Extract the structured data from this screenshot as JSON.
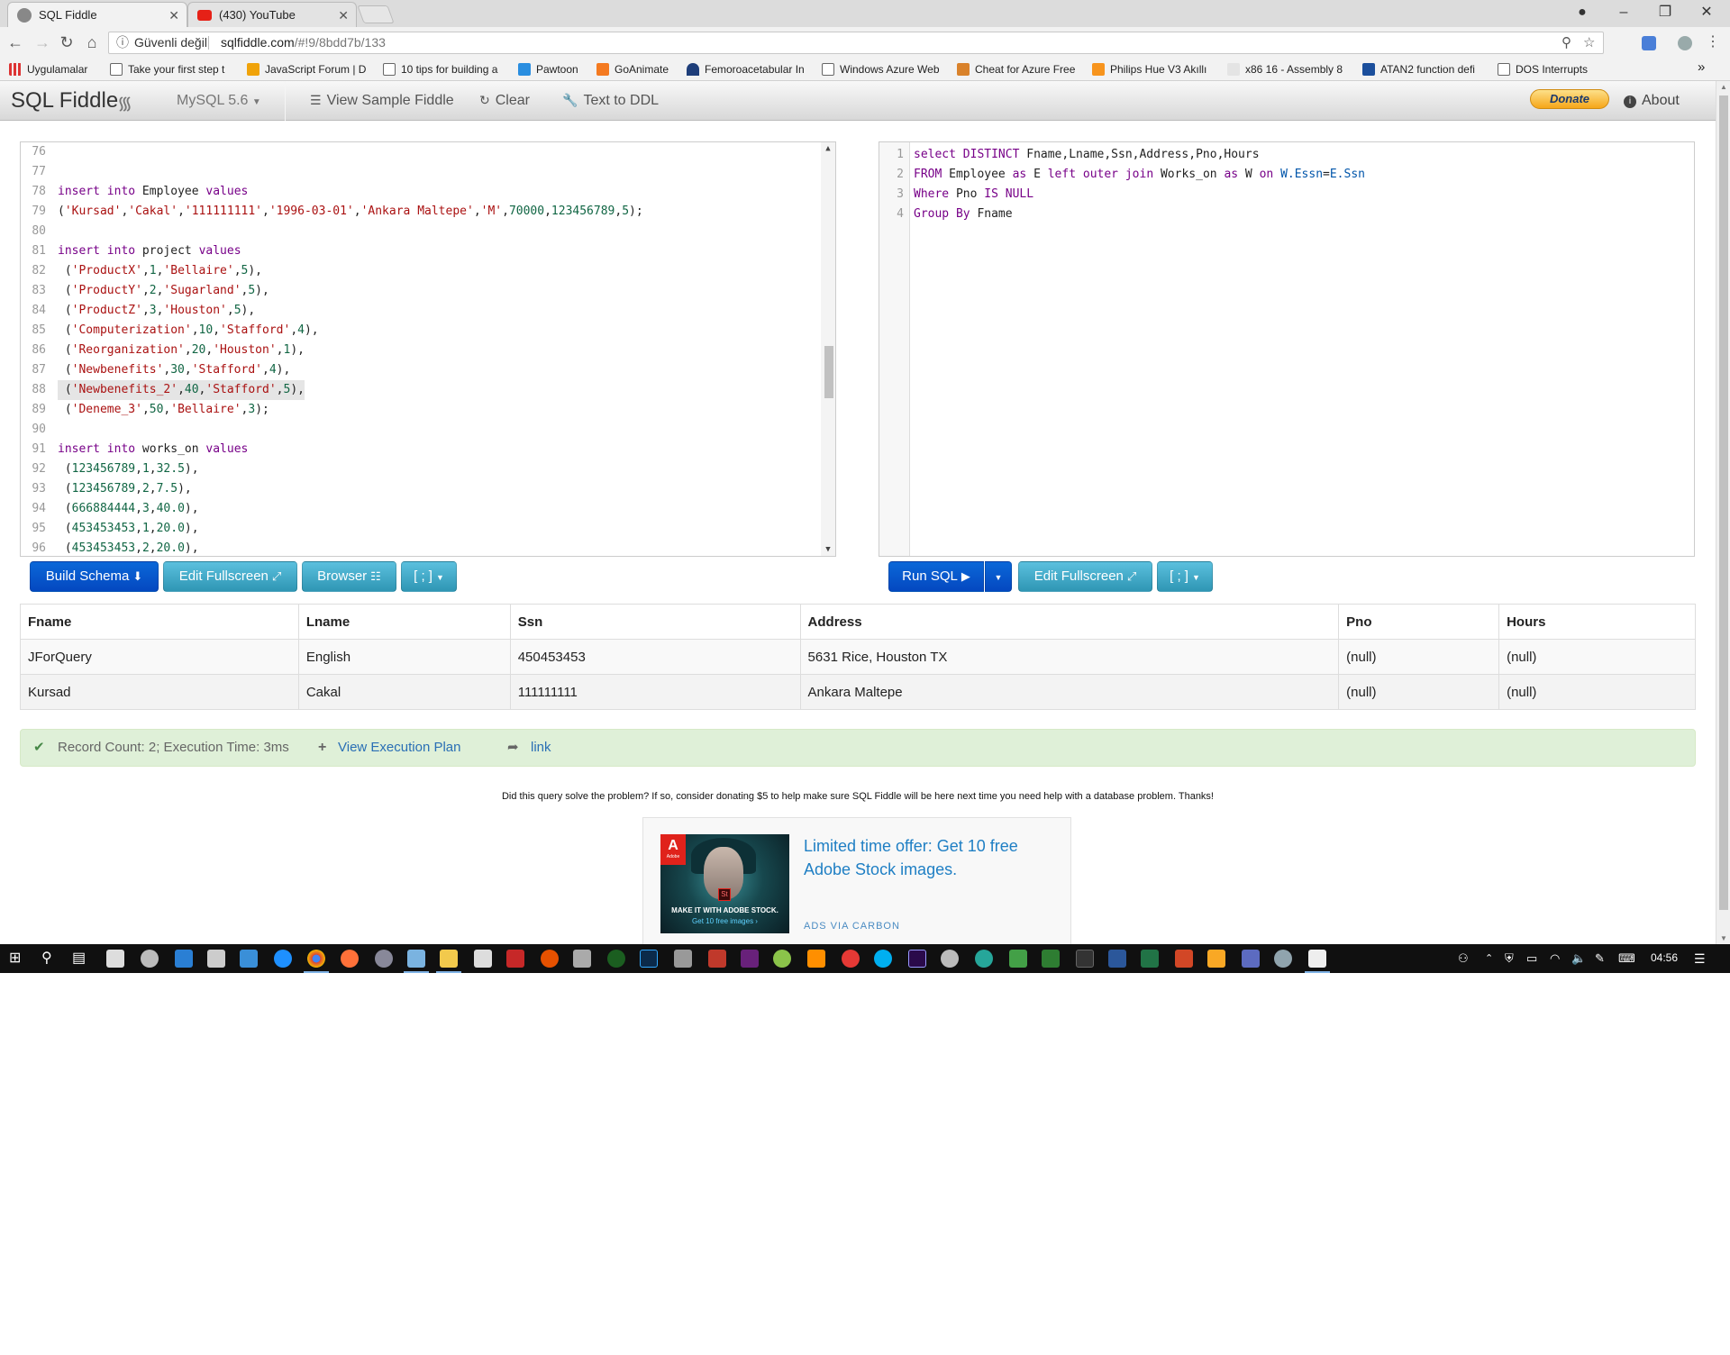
{
  "browser": {
    "tabs": [
      {
        "title": "SQL Fiddle",
        "active": true
      },
      {
        "title": "(430) YouTube",
        "active": false
      }
    ],
    "security_label": "Güvenli değil",
    "url_host": "sqlfiddle.com",
    "url_path": "/#!9/8bdd7b/133",
    "bookmarks": [
      "Uygulamalar",
      "Take your first step t",
      "JavaScript Forum | D",
      "10 tips for building a",
      "Pawtoon",
      "GoAnimate",
      "Femoroacetabular In",
      "Windows Azure Web",
      "Cheat for Azure Free",
      "Philips Hue V3 Akıllı",
      "x86 16 - Assembly 8",
      "ATAN2 function defi",
      "DOS Interrupts"
    ],
    "bookmarks_more": "»"
  },
  "app": {
    "brand": "SQL Fiddle",
    "db_version": "MySQL 5.6",
    "nav": {
      "view_sample": "View Sample Fiddle",
      "clear": "Clear",
      "text_to_ddl": "Text to DDL",
      "donate": "Donate",
      "about": "About"
    }
  },
  "schema_editor": {
    "line_numbers": [
      "76",
      "77",
      "78",
      "79",
      "80",
      "81",
      "82",
      "83",
      "84",
      "85",
      "86",
      "87",
      "88",
      "89",
      "90",
      "91",
      "92",
      "93",
      "94",
      "95",
      "96"
    ],
    "highlighted_line": "88"
  },
  "query_editor": {
    "line_numbers": [
      "1",
      "2",
      "3",
      "4"
    ]
  },
  "buttons": {
    "build_schema": "Build Schema",
    "edit_fullscreen_left": "Edit Fullscreen",
    "browser": "Browser",
    "terminator_left": "[ ; ]",
    "run_sql": "Run SQL",
    "edit_fullscreen_right": "Edit Fullscreen",
    "terminator_right": "[ ; ]"
  },
  "results": {
    "columns": [
      "Fname",
      "Lname",
      "Ssn",
      "Address",
      "Pno",
      "Hours"
    ],
    "rows": [
      [
        "JForQuery",
        "English",
        "450453453",
        "5631 Rice, Houston TX",
        "(null)",
        "(null)"
      ],
      [
        "Kursad",
        "Cakal",
        "111111111",
        "Ankara Maltepe",
        "(null)",
        "(null)"
      ]
    ]
  },
  "status": {
    "summary": "Record Count: 2; Execution Time: 3ms",
    "view_plan": "View Execution Plan",
    "link": "link"
  },
  "donate_message": "Did this query solve the problem? If so, consider donating $5 to help make sure SQL Fiddle will be here next time you need help with a database problem. Thanks!",
  "ad": {
    "headline": "Limited time offer: Get 10 free Adobe Stock images.",
    "via": "ADS VIA CARBON",
    "image_logo": "Adobe",
    "image_badge": "St",
    "image_line1": "MAKE IT WITH ADOBE STOCK.",
    "image_line2": "Get 10 free images ›"
  },
  "taskbar": {
    "clock": "04:56"
  }
}
